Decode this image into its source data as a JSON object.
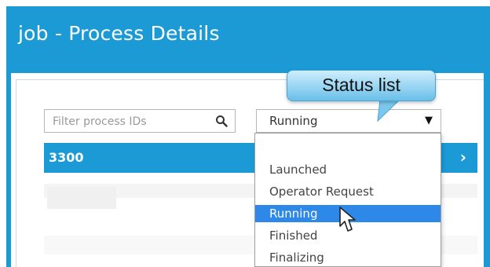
{
  "window": {
    "title": "job - Process Details"
  },
  "filter": {
    "placeholder": "Filter process IDs",
    "icon": "search-icon"
  },
  "status_select": {
    "selected": "Running",
    "arrow": "▼"
  },
  "process_list": {
    "rows": [
      {
        "id": "3300",
        "selected": true
      }
    ],
    "chevron": "›"
  },
  "dropdown": {
    "options": [
      {
        "label": "",
        "selected": false
      },
      {
        "label": "Launched",
        "selected": false
      },
      {
        "label": "Operator Request",
        "selected": false
      },
      {
        "label": "Running",
        "selected": true
      },
      {
        "label": "Finished",
        "selected": false
      },
      {
        "label": "Finalizing",
        "selected": false
      }
    ]
  },
  "callout": {
    "text": "Status list"
  },
  "colors": {
    "brand_blue": "#1b9ad6",
    "selected_option": "#2e88e8",
    "callout_top": "#cfeefc",
    "callout_bottom": "#69bfe9"
  }
}
